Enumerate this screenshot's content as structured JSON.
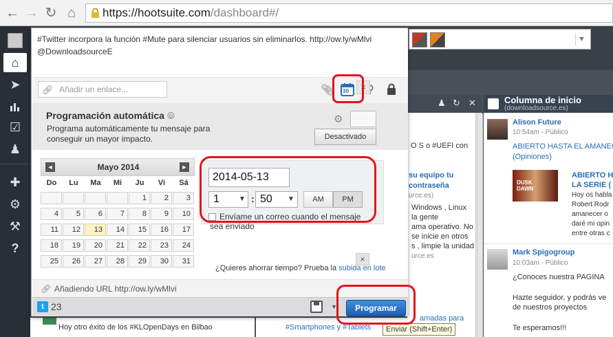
{
  "browser": {
    "url_host": "https://hootsuite.com",
    "url_path": "/dashboard#/"
  },
  "sidebar": {
    "items": [
      "home",
      "send",
      "analytics",
      "assignments",
      "contacts",
      "apps",
      "settings",
      "tools",
      "help"
    ],
    "help_label": "?"
  },
  "composer": {
    "message": "#Twitter incorpora la función #Mute para silenciar usuarios sin eliminarlos. http://ow.ly/wMlvi @DownloadsourceE",
    "link_placeholder": "Añadir un enlace...",
    "calendar_day": "30",
    "auto_title": "Programación automática",
    "auto_description": "Programa automáticamente tu mensaje para conseguir un mayor impacto.",
    "auto_state": "Desactivado",
    "close": "×",
    "calendar": {
      "month": "Mayo 2014",
      "prev": "◄",
      "next": "►",
      "weekdays": [
        "Do",
        "Lu",
        "Ma",
        "Mi",
        "Ju",
        "Vi",
        "Sá"
      ],
      "weeks": [
        [
          "",
          "",
          "",
          "",
          "1",
          "2",
          "3"
        ],
        [
          "4",
          "5",
          "6",
          "7",
          "8",
          "9",
          "10"
        ],
        [
          "11",
          "12",
          "13",
          "14",
          "15",
          "16",
          "17"
        ],
        [
          "18",
          "19",
          "20",
          "21",
          "22",
          "23",
          "24"
        ],
        [
          "25",
          "26",
          "27",
          "28",
          "29",
          "30",
          "31"
        ]
      ],
      "today": "13"
    },
    "date": "2014-05-13",
    "hour": "1",
    "minute": "50",
    "am": "AM",
    "pm": "PM",
    "selected_period": "PM",
    "email_label": "Envíame un correo cuando el mensaje sea enviado",
    "bulk_prefix": "¿Quieres ahorrar tiempo? Prueba la ",
    "bulk_link": "subida en lote",
    "url_row": "Añadiendo URL  http://ow.ly/wMlvi",
    "char_count": "23",
    "submit": "Programar",
    "tooltip": "Enviar (Shift+Enter)"
  },
  "background": {
    "column_right_title": "Columna de inicio",
    "column_right_sub": "(downloadsource.es)",
    "post1_user": "Alison Future",
    "post1_meta": "10:54am - Público",
    "post1_text1": "ABIERTO HASTA EL AMANECER",
    "post1_text2": "(Opiniones)",
    "post1_card_title1": "ABIERTO H",
    "post1_card_title2": "LA SERIE (",
    "post1_card_text": [
      "Hoy os habla",
      "Robert Rodr",
      "amanecer o",
      "daré mi opin",
      "entre otras c"
    ],
    "post2_user": "Mark Spigogroup",
    "post2_meta": "10:03am - Público",
    "post2_text": [
      "¿Conoces nuestra PAGINA",
      "",
      "Hazte seguidor, y podrás ve",
      "de nuestros proyectos",
      "",
      "Te esperamos!!!"
    ],
    "mid_text": [
      "O S o #UEFI con",
      "",
      "su equipo tu",
      "contraseña",
      "urce.es)",
      "Windows , Linux",
      "la gente",
      "ama operativo. No",
      "se inicie en otros",
      "s , limpie la unidad ,",
      "urce.es"
    ],
    "bottom_left": "Hoy otro éxito de los #KLOpenDays en Bilbao",
    "bottom_mid": "#Smartphones y #Tablets",
    "bottom_mid_top": "amadas para"
  },
  "colors": {
    "accent": "#1d5fb3",
    "annotation": "#e0141e",
    "sidebar": "#2a2f36"
  }
}
